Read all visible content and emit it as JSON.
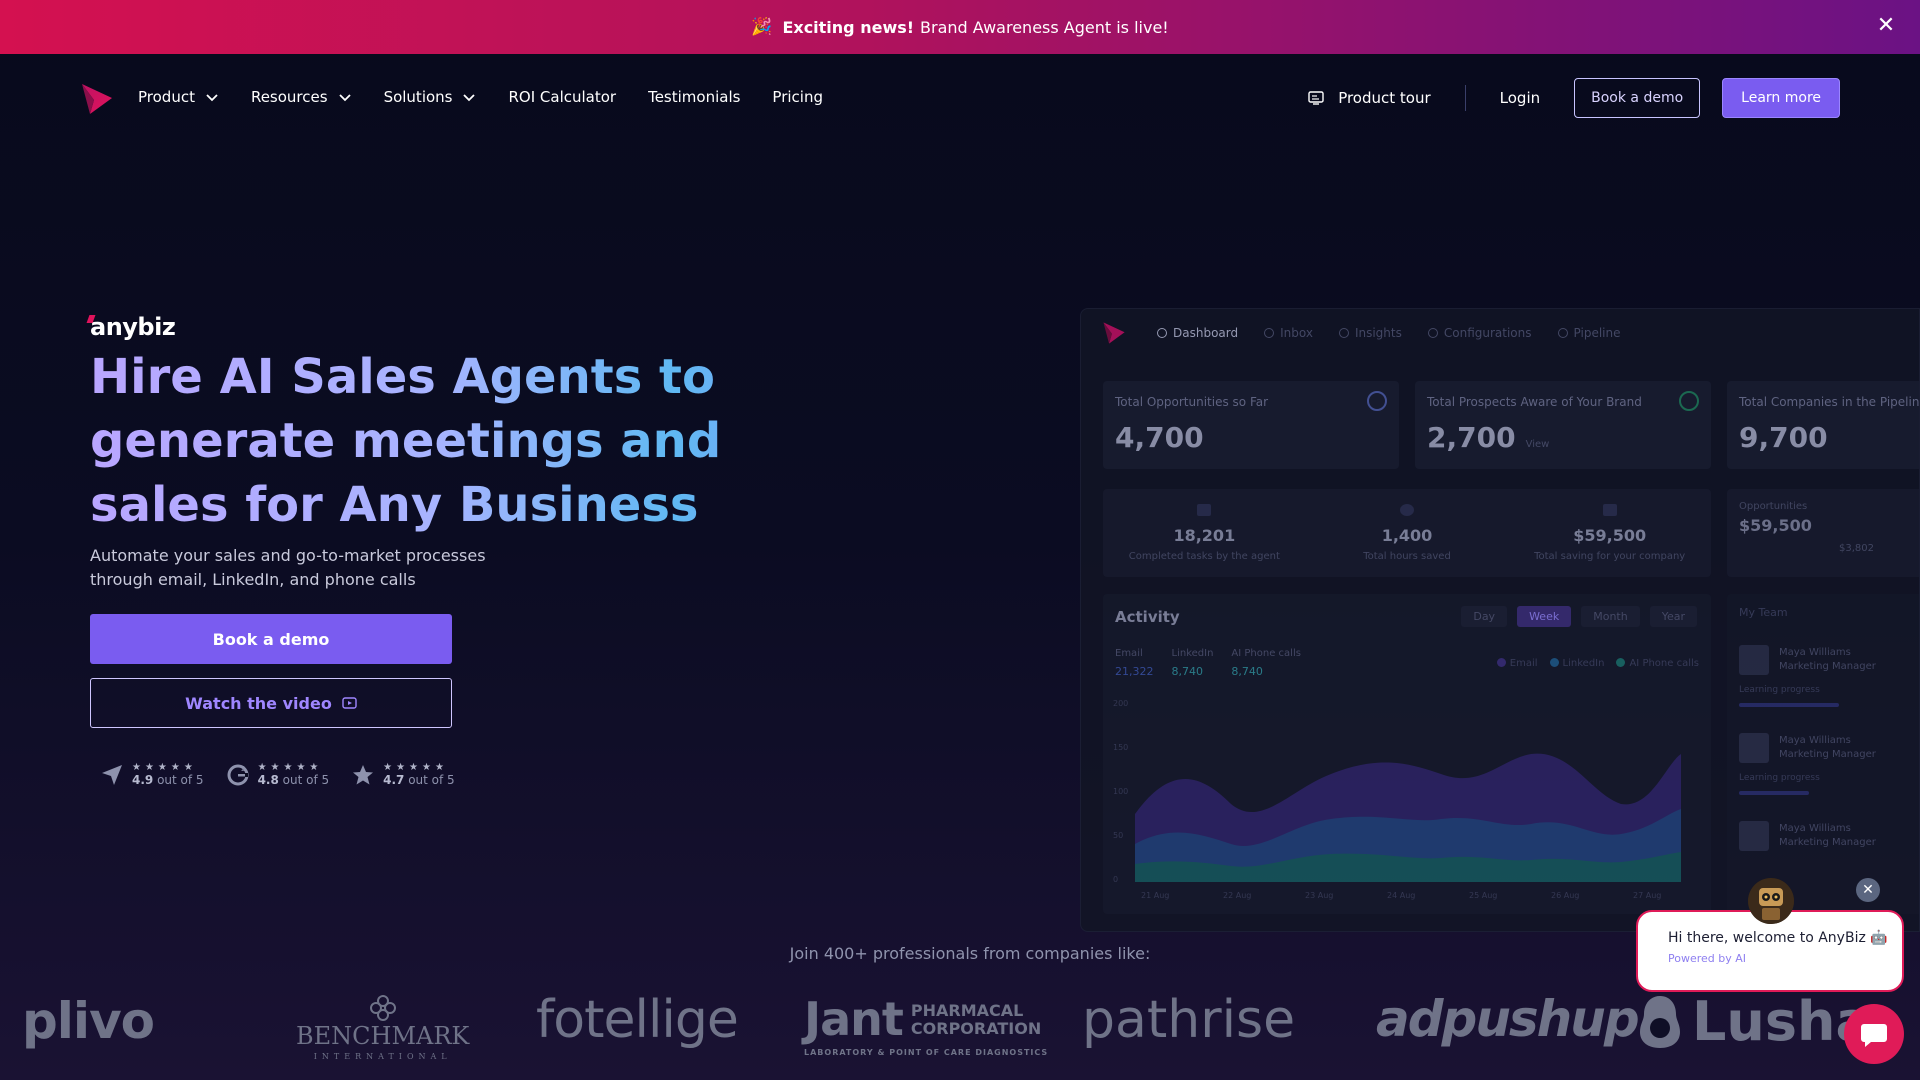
{
  "announcement": {
    "emoji": "🎉",
    "bold_text": "Exciting news!",
    "text": "Brand Awareness Agent is live!",
    "close_glyph": "✕"
  },
  "nav": {
    "items": [
      {
        "label": "Product",
        "has_dropdown": true
      },
      {
        "label": "Resources",
        "has_dropdown": true
      },
      {
        "label": "Solutions",
        "has_dropdown": true
      },
      {
        "label": "ROI Calculator",
        "has_dropdown": false
      },
      {
        "label": "Testimonials",
        "has_dropdown": false
      },
      {
        "label": "Pricing",
        "has_dropdown": false
      }
    ],
    "product_tour": "Product tour",
    "login": "Login",
    "book_demo": "Book a demo",
    "learn_more": "Learn more"
  },
  "hero": {
    "brand": "anybiz",
    "headline": "Hire AI Sales Agents to generate meetings and sales for Any Business",
    "subtitle": "Automate your sales and go-to-market processes through email, LinkedIn, and phone calls",
    "cta_primary": "Book a demo",
    "cta_secondary": "Watch the video",
    "ratings": [
      {
        "icon": "send-arrow-icon",
        "stars": "★★★★★",
        "score": "4.9",
        "suffix": " out of 5"
      },
      {
        "icon": "g2-icon",
        "stars": "★★★★★",
        "score": "4.8",
        "suffix": " out of 5"
      },
      {
        "icon": "star-icon",
        "stars": "★★★★★",
        "score": "4.7",
        "suffix": " out of 5"
      }
    ]
  },
  "dashboard": {
    "tabs": [
      "Dashboard",
      "Inbox",
      "Insights",
      "Configurations",
      "Pipeline"
    ],
    "cards": [
      {
        "label": "Total Opportunities so Far",
        "value": "4,700"
      },
      {
        "label": "Total Prospects Aware of Your Brand",
        "value": "2,700",
        "extra": "View"
      },
      {
        "label": "Total Companies in the Pipeline",
        "value": "9,700"
      }
    ],
    "stats": [
      {
        "value": "18,201",
        "label": "Completed tasks by the agent"
      },
      {
        "value": "1,400",
        "label": "Total hours saved"
      },
      {
        "value": "$59,500",
        "label": "Total saving for your company"
      }
    ],
    "side": {
      "label": "Opportunities",
      "value": "$59,500",
      "sub": "$3,802"
    },
    "activity": {
      "title": "Activity",
      "periods": [
        "Day",
        "Week",
        "Month",
        "Year"
      ],
      "active_period": "Week",
      "metrics": [
        {
          "label": "Email",
          "value": "21,322"
        },
        {
          "label": "LinkedIn",
          "value": "8,740"
        },
        {
          "label": "AI Phone calls",
          "value": "8,740"
        }
      ],
      "legend": [
        "Email",
        "LinkedIn",
        "AI Phone calls"
      ],
      "y_ticks": [
        "200",
        "150",
        "100",
        "50",
        "0"
      ],
      "x_ticks": [
        "21 Aug",
        "22 Aug",
        "23 Aug",
        "24 Aug",
        "25 Aug",
        "26 Aug",
        "27 Aug"
      ]
    },
    "team": {
      "title": "My Team",
      "members": [
        {
          "name": "Maya Williams",
          "role": "Marketing Manager",
          "status": "Learning progress"
        },
        {
          "name": "Maya Williams",
          "role": "Marketing Manager",
          "status": "Learning progress"
        },
        {
          "name": "Maya Williams",
          "role": "Marketing Manager",
          "status": ""
        }
      ]
    },
    "colors": {
      "email": "#4a2f9a",
      "linkedin": "#2a4f9a",
      "phone": "#1f7f86"
    }
  },
  "join_text": "Join 400+ professionals from companies like:",
  "logos": {
    "plivo": "plivo",
    "benchmark": "BENCHMARK",
    "benchmark_sub": "INTERNATIONAL",
    "fotellige": "fotellige",
    "jant": "Jant",
    "jant_side1": "PHARMACAL",
    "jant_side2": "CORPORATION",
    "jant_sub": "LABORATORY & POINT OF CARE DIAGNOSTICS",
    "pathrise": "pathrise",
    "adpushup": "adpushup",
    "lusha": "Lusha"
  },
  "chat": {
    "greeting": "Hi there, welcome to AnyBiz 🤖",
    "powered": "Powered by AI",
    "close_glyph": "✕"
  },
  "theme": {
    "accent": "#7a5cf0",
    "announce_start": "#d41150",
    "announce_end": "#6b1284",
    "chat_accent": "#e01b58",
    "background": "#0a0b1e"
  }
}
